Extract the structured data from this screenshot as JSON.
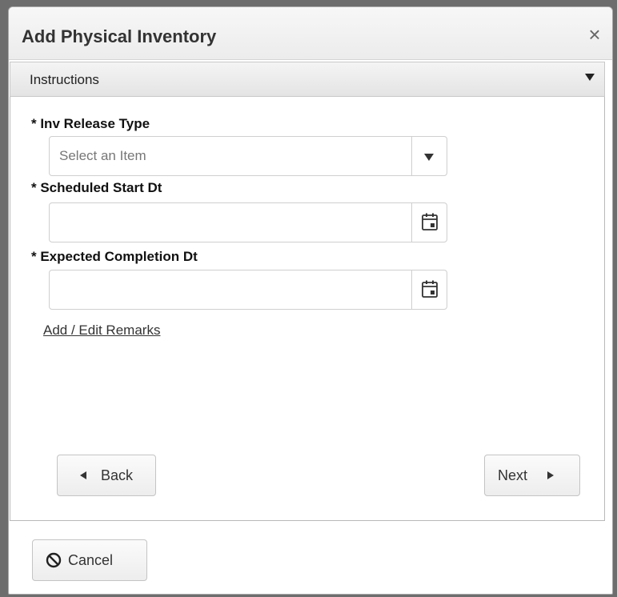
{
  "dialog": {
    "title": "Add Physical Inventory",
    "close_icon": "close-icon"
  },
  "instructions": {
    "label": "Instructions",
    "icon": "chevron-down-icon"
  },
  "form": {
    "release_type": {
      "label": "* Inv Release Type",
      "placeholder": "Select an Item",
      "value": ""
    },
    "start_date": {
      "label": "* Scheduled Start Dt",
      "value": "",
      "icon": "calendar-icon"
    },
    "completion_date": {
      "label": "* Expected Completion Dt",
      "value": "",
      "icon": "calendar-icon"
    },
    "remarks_link": "Add / Edit Remarks"
  },
  "wizard": {
    "back_label": "Back",
    "next_label": "Next"
  },
  "footer": {
    "cancel_label": "Cancel",
    "cancel_icon": "ban-icon"
  }
}
